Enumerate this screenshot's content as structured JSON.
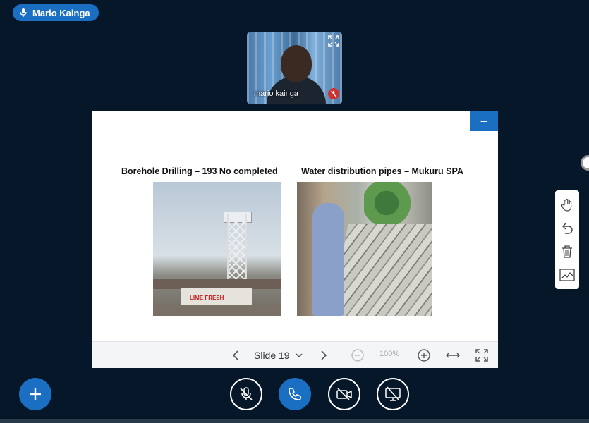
{
  "speaker": {
    "name": "Mario Kainga",
    "icon": "microphone-icon"
  },
  "webcam": {
    "participant_label": "mario kainga"
  },
  "presentation": {
    "minimize_label": "−",
    "slide": {
      "left_caption": "Borehole Drilling – 193 No completed",
      "right_caption": "Water distribution pipes – Mukuru SPA",
      "photo_text": "LIME FRESH"
    },
    "toolbar": {
      "slide_label": "Slide 19",
      "zoom_label": "100%"
    }
  },
  "colors": {
    "accent": "#1b6fc2",
    "background": "#06172a",
    "danger": "#d0312d"
  }
}
